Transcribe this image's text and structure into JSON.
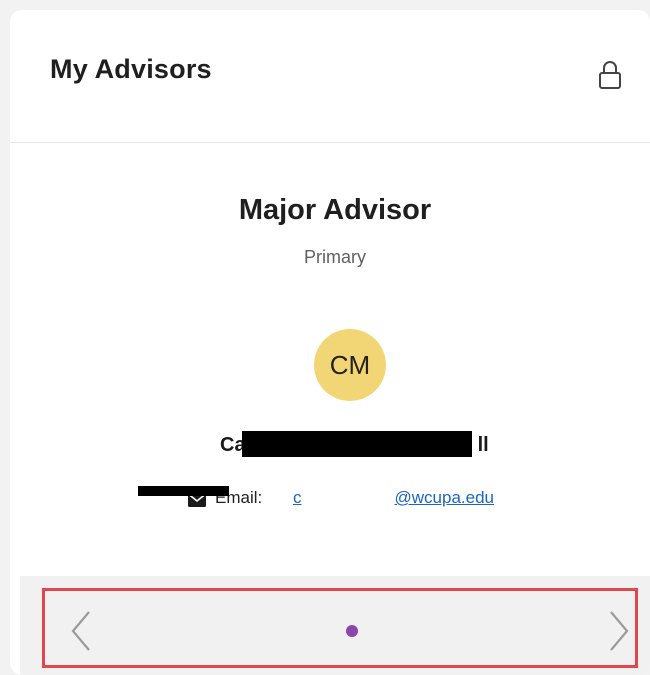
{
  "header": {
    "title": "My Advisors",
    "lock_icon": "lock-icon"
  },
  "advisor": {
    "role": "Major Advisor",
    "type": "Primary",
    "initials": "CM",
    "name_start": "Ca",
    "name_end": "ll",
    "email_label": "Email:",
    "email_value": "cpu.....ll@wcupa.edu",
    "email_link_text_start": "c",
    "email_link_text_end": "@wcupa.edu",
    "avatar_color": "#f2d574",
    "mail_icon": "envelope-icon"
  },
  "carousel": {
    "prev_icon": "chevron-left-icon",
    "next_icon": "chevron-right-icon",
    "total_pages": 1,
    "current_page": 1,
    "dot_color": "#8e44ad",
    "highlight_color": "#e1474f"
  }
}
